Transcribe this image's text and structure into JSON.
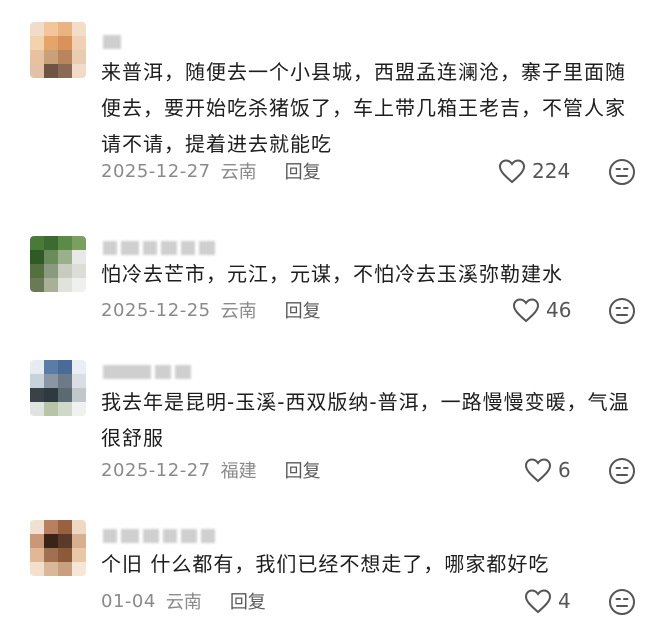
{
  "comments": [
    {
      "text": "来普洱，随便去一个小县城，西盟孟连澜沧，寨子里面随便去，要开始吃杀猪饭了，车上带几箱王老吉，不管人家请不请，提着进去就能吃",
      "date": "2025-12-27",
      "location": "云南",
      "reply_label": "回复",
      "likes": "224",
      "avatar_colors": [
        "#f1dccc",
        "#f4c49a",
        "#e9b482",
        "#f3dcc8",
        "#f5d2ae",
        "#e6a36a",
        "#d9935a",
        "#f1d0b3",
        "#e8c2a0",
        "#caa07a",
        "#b98560",
        "#e9cdb2",
        "#e1c2a6",
        "#6e5444",
        "#8a6a52",
        "#f0dac8"
      ]
    },
    {
      "text": "怕冷去芒市，元江，元谋，不怕冷去玉溪弥勒建水",
      "date": "2025-12-25",
      "location": "云南",
      "reply_label": "回复",
      "likes": "46",
      "avatar_colors": [
        "#4a7a3a",
        "#3d6a30",
        "#5c8a48",
        "#7aa060",
        "#2f5a28",
        "#6b8c5a",
        "#9ab088",
        "#e8e8e8",
        "#54703f",
        "#8a9a80",
        "#c8ccc0",
        "#dcdcd8",
        "#6a7a58",
        "#a8b098",
        "#e0e2dc",
        "#f0f0ee"
      ]
    },
    {
      "text": "我去年是昆明-玉溪-西双版纳-普洱，一路慢慢变暖，气温很舒服",
      "date": "2025-12-27",
      "location": "福建",
      "reply_label": "回复",
      "likes": "6",
      "avatar_colors": [
        "#e6ecf2",
        "#5a7ca8",
        "#4a6a98",
        "#e8eef4",
        "#c8d2dc",
        "#8a96a4",
        "#6e7a88",
        "#d8dee4",
        "#3a4248",
        "#2e3a40",
        "#5a6a70",
        "#c0c8cc",
        "#e0e4e0",
        "#b8c4a8",
        "#d0d8c8",
        "#f0f2f0"
      ]
    },
    {
      "text": "个旧 什么都有，我们已经不想走了，哪家都好吃",
      "date": "01-04",
      "location": "云南",
      "reply_label": "回复",
      "likes": "4",
      "avatar_colors": [
        "#f0e0d0",
        "#b88060",
        "#9a6040",
        "#eed8c4",
        "#c89878",
        "#3a2418",
        "#5a3a28",
        "#d8b090",
        "#e0b898",
        "#a07050",
        "#8a5a3a",
        "#e8c8a8",
        "#f2e0cc",
        "#d8b898",
        "#c8a080",
        "#f4e6d8"
      ]
    }
  ],
  "icons": {
    "like": "heart-outline-icon",
    "dislike": "meh-face-icon"
  }
}
